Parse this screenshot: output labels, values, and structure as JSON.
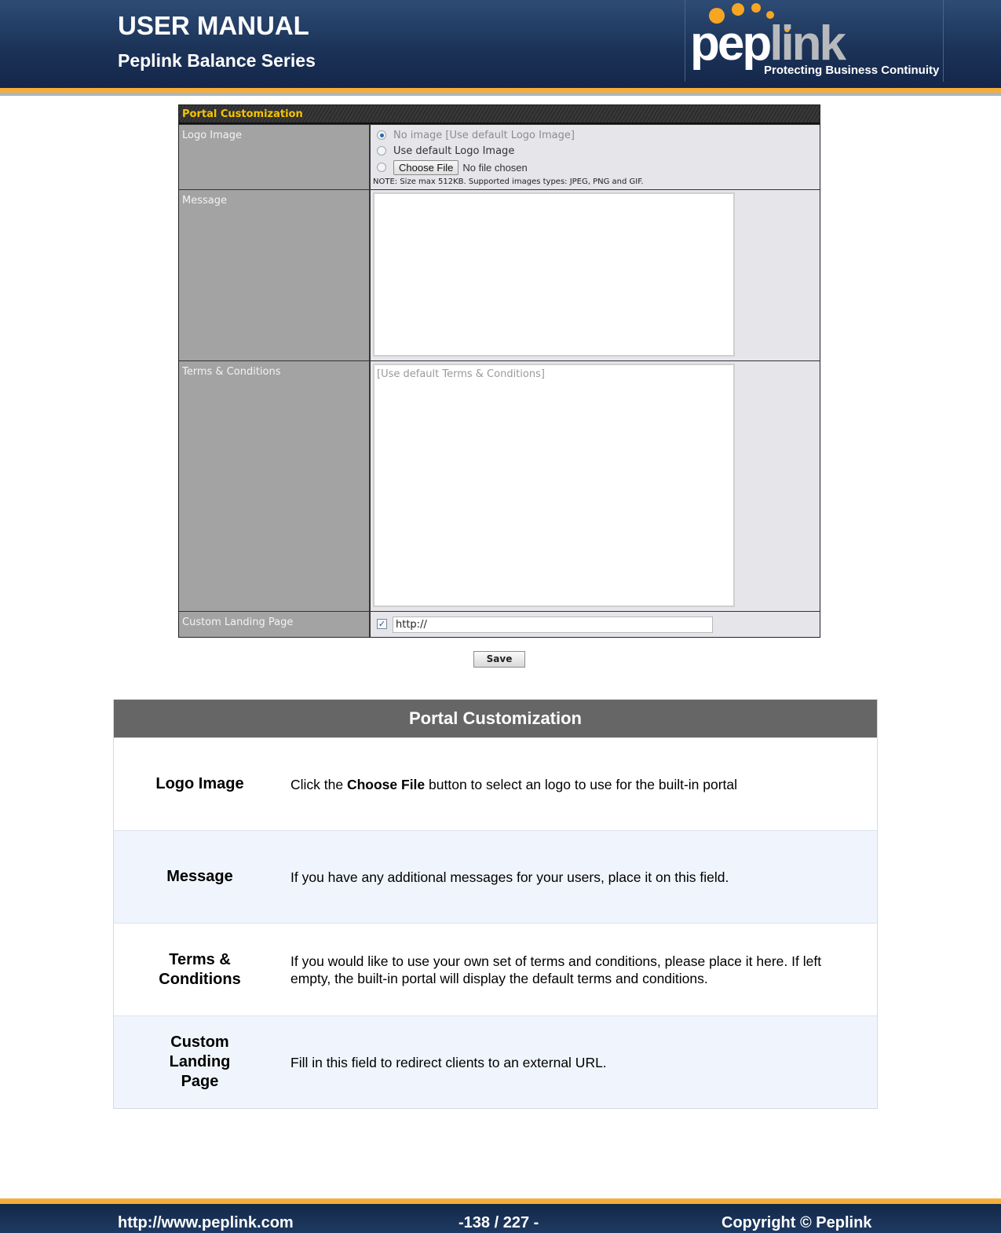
{
  "header": {
    "title": "USER MANUAL",
    "subtitle": "Peplink Balance Series",
    "logo_pep": "pep",
    "logo_link": "link",
    "logo_tagline": "Protecting Business Continuity"
  },
  "panel": {
    "title": "Portal Customization",
    "rows": {
      "logo": {
        "label": "Logo Image",
        "options": [
          {
            "label": "No image [Use default Logo Image]",
            "checked": true
          },
          {
            "label": "Use default Logo Image",
            "checked": false
          },
          {
            "label": "",
            "checked": false
          }
        ],
        "choose_file_label": "Choose File",
        "file_status": "No file chosen",
        "note": "NOTE: Size max 512KB. Supported images types: JPEG, PNG and GIF."
      },
      "message": {
        "label": "Message",
        "value": ""
      },
      "terms": {
        "label": "Terms & Conditions",
        "placeholder": "[Use default Terms & Conditions]"
      },
      "landing": {
        "label": "Custom Landing Page",
        "checked": true,
        "checkbox_glyph": "✓",
        "url_value": "http://"
      }
    },
    "save_label": "Save"
  },
  "description": {
    "title": "Portal Customization",
    "rows": [
      {
        "name": "Logo Image",
        "text_before": "Click the ",
        "text_bold": "Choose File",
        "text_after": " button to select an logo to use for the built-in portal"
      },
      {
        "name": "Message",
        "text": "If you have any additional messages for your users, place it on this field."
      },
      {
        "name_line1": "Terms &",
        "name_line2": "Conditions",
        "text": "If you would like to use your own set of terms and conditions, please place it here. If left empty, the built-in portal will display the default terms and conditions."
      },
      {
        "name_line1": "Custom",
        "name_line2": "Landing",
        "name_line3": "Page",
        "text": "Fill in this field to redirect clients to an external URL."
      }
    ]
  },
  "footer": {
    "url": "http://www.peplink.com",
    "page": "-138 / 227 -",
    "copyright": "Copyright ©  Peplink"
  },
  "colors": {
    "header_blue": "#1c3358",
    "accent_orange": "#f6ae3a",
    "panel_title_yellow": "#f6c400",
    "desc_header_gray": "#666666",
    "alt_row_blue": "#f0f5fd"
  }
}
